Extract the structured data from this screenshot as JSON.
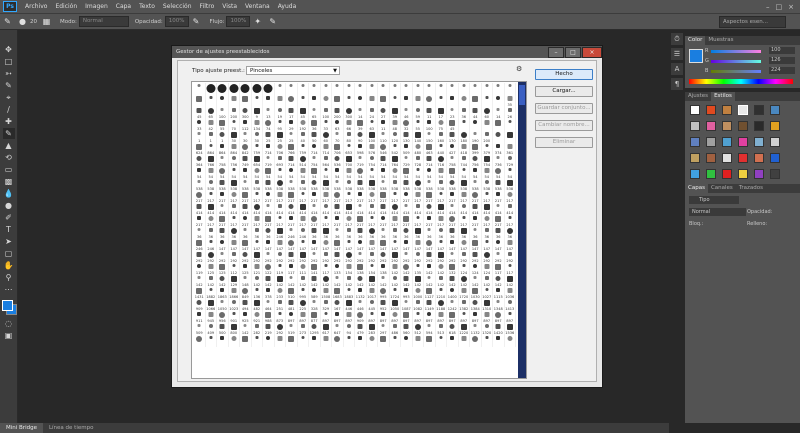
{
  "app": {
    "logo": "Ps"
  },
  "menu": [
    "Archivo",
    "Edición",
    "Imagen",
    "Capa",
    "Texto",
    "Selección",
    "Filtro",
    "Vista",
    "Ventana",
    "Ayuda"
  ],
  "options": {
    "brush_size": "20",
    "mode_label": "Modo:",
    "mode_value": "Normal",
    "opacity_label": "Opacidad:",
    "opacity_value": "100%",
    "flow_label": "Flujo:",
    "flow_value": "100%",
    "workspace": "Aspectos esen..."
  },
  "bottom_tabs": [
    "Mini Bridge",
    "Línea de tiempo"
  ],
  "dialog": {
    "title": "Gestor de ajustes preestablecidos",
    "type_label": "Tipo ajuste preest.:",
    "type_value": "Pinceles",
    "buttons": {
      "done": "Hecho",
      "load": "Cargar...",
      "save": "Guardar conjunto...",
      "rename": "Cambiar nombre...",
      "delete": "Eliminar"
    },
    "brush_rows": [
      [
        "",
        "",
        "",
        "",
        "",
        "",
        "",
        "",
        "",
        "",
        "",
        "",
        "",
        "",
        "",
        "",
        "",
        "",
        "",
        "",
        "",
        "",
        "",
        "",
        "",
        "",
        "",
        ""
      ],
      [
        "",
        "",
        "",
        "",
        "",
        "",
        "",
        "",
        "",
        "",
        "",
        "",
        "",
        "",
        "",
        "",
        "",
        "",
        "",
        "",
        "",
        "",
        "",
        "",
        "",
        "",
        "",
        "35"
      ],
      [
        "45",
        "65",
        "100",
        "200",
        "300",
        "9",
        "13",
        "19",
        "17",
        "45",
        "65",
        "100",
        "200",
        "300",
        "14",
        "24",
        "27",
        "39",
        "46",
        "59",
        "11",
        "17",
        "23",
        "36",
        "44",
        "60",
        "14",
        "26"
      ],
      [
        "33",
        "42",
        "55",
        "70",
        "112",
        "134",
        "74",
        "95",
        "29",
        "192",
        "36",
        "33",
        "63",
        "66",
        "39",
        "63",
        "11",
        "48",
        "32",
        "55",
        "100",
        "75",
        "45",
        "",
        "",
        "",
        "",
        ""
      ],
      [
        "1",
        "1",
        "1",
        "30",
        "30",
        "30",
        "25",
        "25",
        "25",
        "40",
        "50",
        "60",
        "70",
        "80",
        "90",
        "100",
        "110",
        "120",
        "130",
        "140",
        "150",
        "160",
        "170",
        "180",
        "190",
        "200",
        "",
        ""
      ],
      [
        "624",
        "864",
        "864",
        "864",
        "842",
        "759",
        "714",
        "706",
        "766",
        "759",
        "714",
        "714",
        "706",
        "653",
        "598",
        "576",
        "546",
        "542",
        "509",
        "480",
        "463",
        "440",
        "427",
        "418",
        "399",
        "379",
        "374",
        "361"
      ],
      [
        "364",
        "766",
        "758",
        "756",
        "749",
        "654",
        "719",
        "693",
        "714",
        "514",
        "754",
        "564",
        "536",
        "700",
        "719",
        "754",
        "714",
        "764",
        "729",
        "728",
        "714",
        "716",
        "758",
        "744",
        "756",
        "754",
        "736",
        "729"
      ],
      [
        "54",
        "54",
        "54",
        "54",
        "54",
        "54",
        "54",
        "54",
        "54",
        "54",
        "54",
        "54",
        "54",
        "54",
        "54",
        "54",
        "54",
        "54",
        "54",
        "54",
        "54",
        "54",
        "54",
        "54",
        "54",
        "54",
        "54",
        "54"
      ],
      [
        "538",
        "538",
        "538",
        "538",
        "538",
        "538",
        "538",
        "538",
        "538",
        "538",
        "538",
        "538",
        "538",
        "538",
        "538",
        "538",
        "538",
        "538",
        "538",
        "538",
        "538",
        "538",
        "538",
        "538",
        "538",
        "538",
        "538",
        "538"
      ],
      [
        "217",
        "217",
        "217",
        "217",
        "217",
        "217",
        "217",
        "217",
        "217",
        "217",
        "217",
        "217",
        "217",
        "217",
        "217",
        "217",
        "217",
        "217",
        "217",
        "217",
        "217",
        "217",
        "217",
        "217",
        "217",
        "217",
        "217",
        "217"
      ],
      [
        "414",
        "414",
        "414",
        "414",
        "414",
        "414",
        "414",
        "414",
        "414",
        "414",
        "414",
        "414",
        "414",
        "414",
        "414",
        "414",
        "414",
        "414",
        "414",
        "414",
        "414",
        "414",
        "414",
        "414",
        "414",
        "414",
        "414",
        "414"
      ],
      [
        "217",
        "217",
        "217",
        "217",
        "217",
        "217",
        "217",
        "217",
        "217",
        "217",
        "217",
        "217",
        "217",
        "217",
        "217",
        "217",
        "217",
        "217",
        "217",
        "217",
        "217",
        "217",
        "217",
        "217",
        "217",
        "217",
        "217",
        "217"
      ],
      [
        "36",
        "36",
        "36",
        "36",
        "36",
        "36",
        "36",
        "246",
        "246",
        "246",
        "36",
        "36",
        "36",
        "36",
        "36",
        "36",
        "36",
        "36",
        "36",
        "36",
        "36",
        "36",
        "36",
        "36",
        "36",
        "36",
        "36",
        "36"
      ],
      [
        "246",
        "246",
        "147",
        "147",
        "147",
        "147",
        "147",
        "147",
        "147",
        "147",
        "147",
        "147",
        "147",
        "147",
        "147",
        "147",
        "147",
        "147",
        "147",
        "147",
        "147",
        "147",
        "147",
        "147",
        "147",
        "147",
        "147",
        "147"
      ],
      [
        "292",
        "292",
        "292",
        "292",
        "292",
        "292",
        "292",
        "292",
        "292",
        "292",
        "292",
        "292",
        "292",
        "292",
        "292",
        "292",
        "292",
        "292",
        "292",
        "292",
        "292",
        "292",
        "292",
        "292",
        "292",
        "292",
        "292",
        "292"
      ],
      [
        "119",
        "125",
        "125",
        "112",
        "125",
        "121",
        "122",
        "119",
        "117",
        "111",
        "141",
        "117",
        "133",
        "154",
        "138",
        "154",
        "138",
        "142",
        "142",
        "135",
        "142",
        "142",
        "132",
        "124",
        "124",
        "124",
        "117",
        "117"
      ],
      [
        "142",
        "142",
        "142",
        "129",
        "148",
        "142",
        "142",
        "142",
        "142",
        "142",
        "142",
        "142",
        "142",
        "142",
        "142",
        "142",
        "142",
        "142",
        "142",
        "142",
        "142",
        "142",
        "142",
        "142",
        "142",
        "142",
        "142",
        "142"
      ],
      [
        "1431",
        "1882",
        "1863",
        "1866",
        "849",
        "136",
        "378",
        "233",
        "510",
        "995",
        "589",
        "1508",
        "1683",
        "1883",
        "1132",
        "1017",
        "995",
        "1724",
        "993",
        "1000",
        "1127",
        "1210",
        "1400",
        "1720",
        "1030",
        "1027",
        "1115",
        "1036"
      ],
      [
        "909",
        "1066",
        "1050",
        "1023",
        "494",
        "482",
        "464",
        "251",
        "481",
        "225",
        "328",
        "329",
        "167",
        "446",
        "446",
        "445",
        "952",
        "1050",
        "1087",
        "1082",
        "1149",
        "1188",
        "1242",
        "1382",
        "1384",
        "1310",
        "1348",
        "1413"
      ],
      [
        "911",
        "945",
        "956",
        "901",
        "925",
        "921",
        "988",
        "873",
        "897",
        "897",
        "877",
        "897",
        "897",
        "897",
        "909",
        "897",
        "897",
        "897",
        "897",
        "897",
        "897",
        "897",
        "897",
        "897",
        "897",
        "897",
        "897",
        "897"
      ],
      [
        "509",
        "409",
        "500",
        "800",
        "142",
        "282",
        "219",
        "292",
        "519",
        "273",
        "1295",
        "617",
        "647",
        "94",
        "479",
        "283",
        "297",
        "486",
        "560",
        "512",
        "594",
        "513",
        "618",
        "1220",
        "1132",
        "1320",
        "1420",
        "1536"
      ],
      [
        "",
        "",
        "",
        "",
        "",
        "",
        "",
        "",
        "",
        "",
        "",
        "",
        "",
        "",
        "",
        "",
        "",
        "",
        "",
        "",
        "",
        "",
        "",
        "",
        "",
        "",
        "",
        ""
      ]
    ]
  },
  "right": {
    "color_tabs": [
      "Color",
      "Muestras"
    ],
    "color_channels": [
      "R",
      "G",
      "B"
    ],
    "color_values": [
      "100",
      "126",
      "224"
    ],
    "adjust_tabs": [
      "Ajustes",
      "Estilos"
    ],
    "layers_tabs": [
      "Capas",
      "Canales",
      "Trazados"
    ],
    "layers_kind": "Tipo",
    "layers_mode": "Normal",
    "layers_opacity": "Opacidad:",
    "layers_lock": "Bloq.:",
    "layers_fill": "Relleno:"
  },
  "colors": {
    "accent": "#31a8ff",
    "fg": "#1a7ee0",
    "scroll": "#1c2f66"
  }
}
